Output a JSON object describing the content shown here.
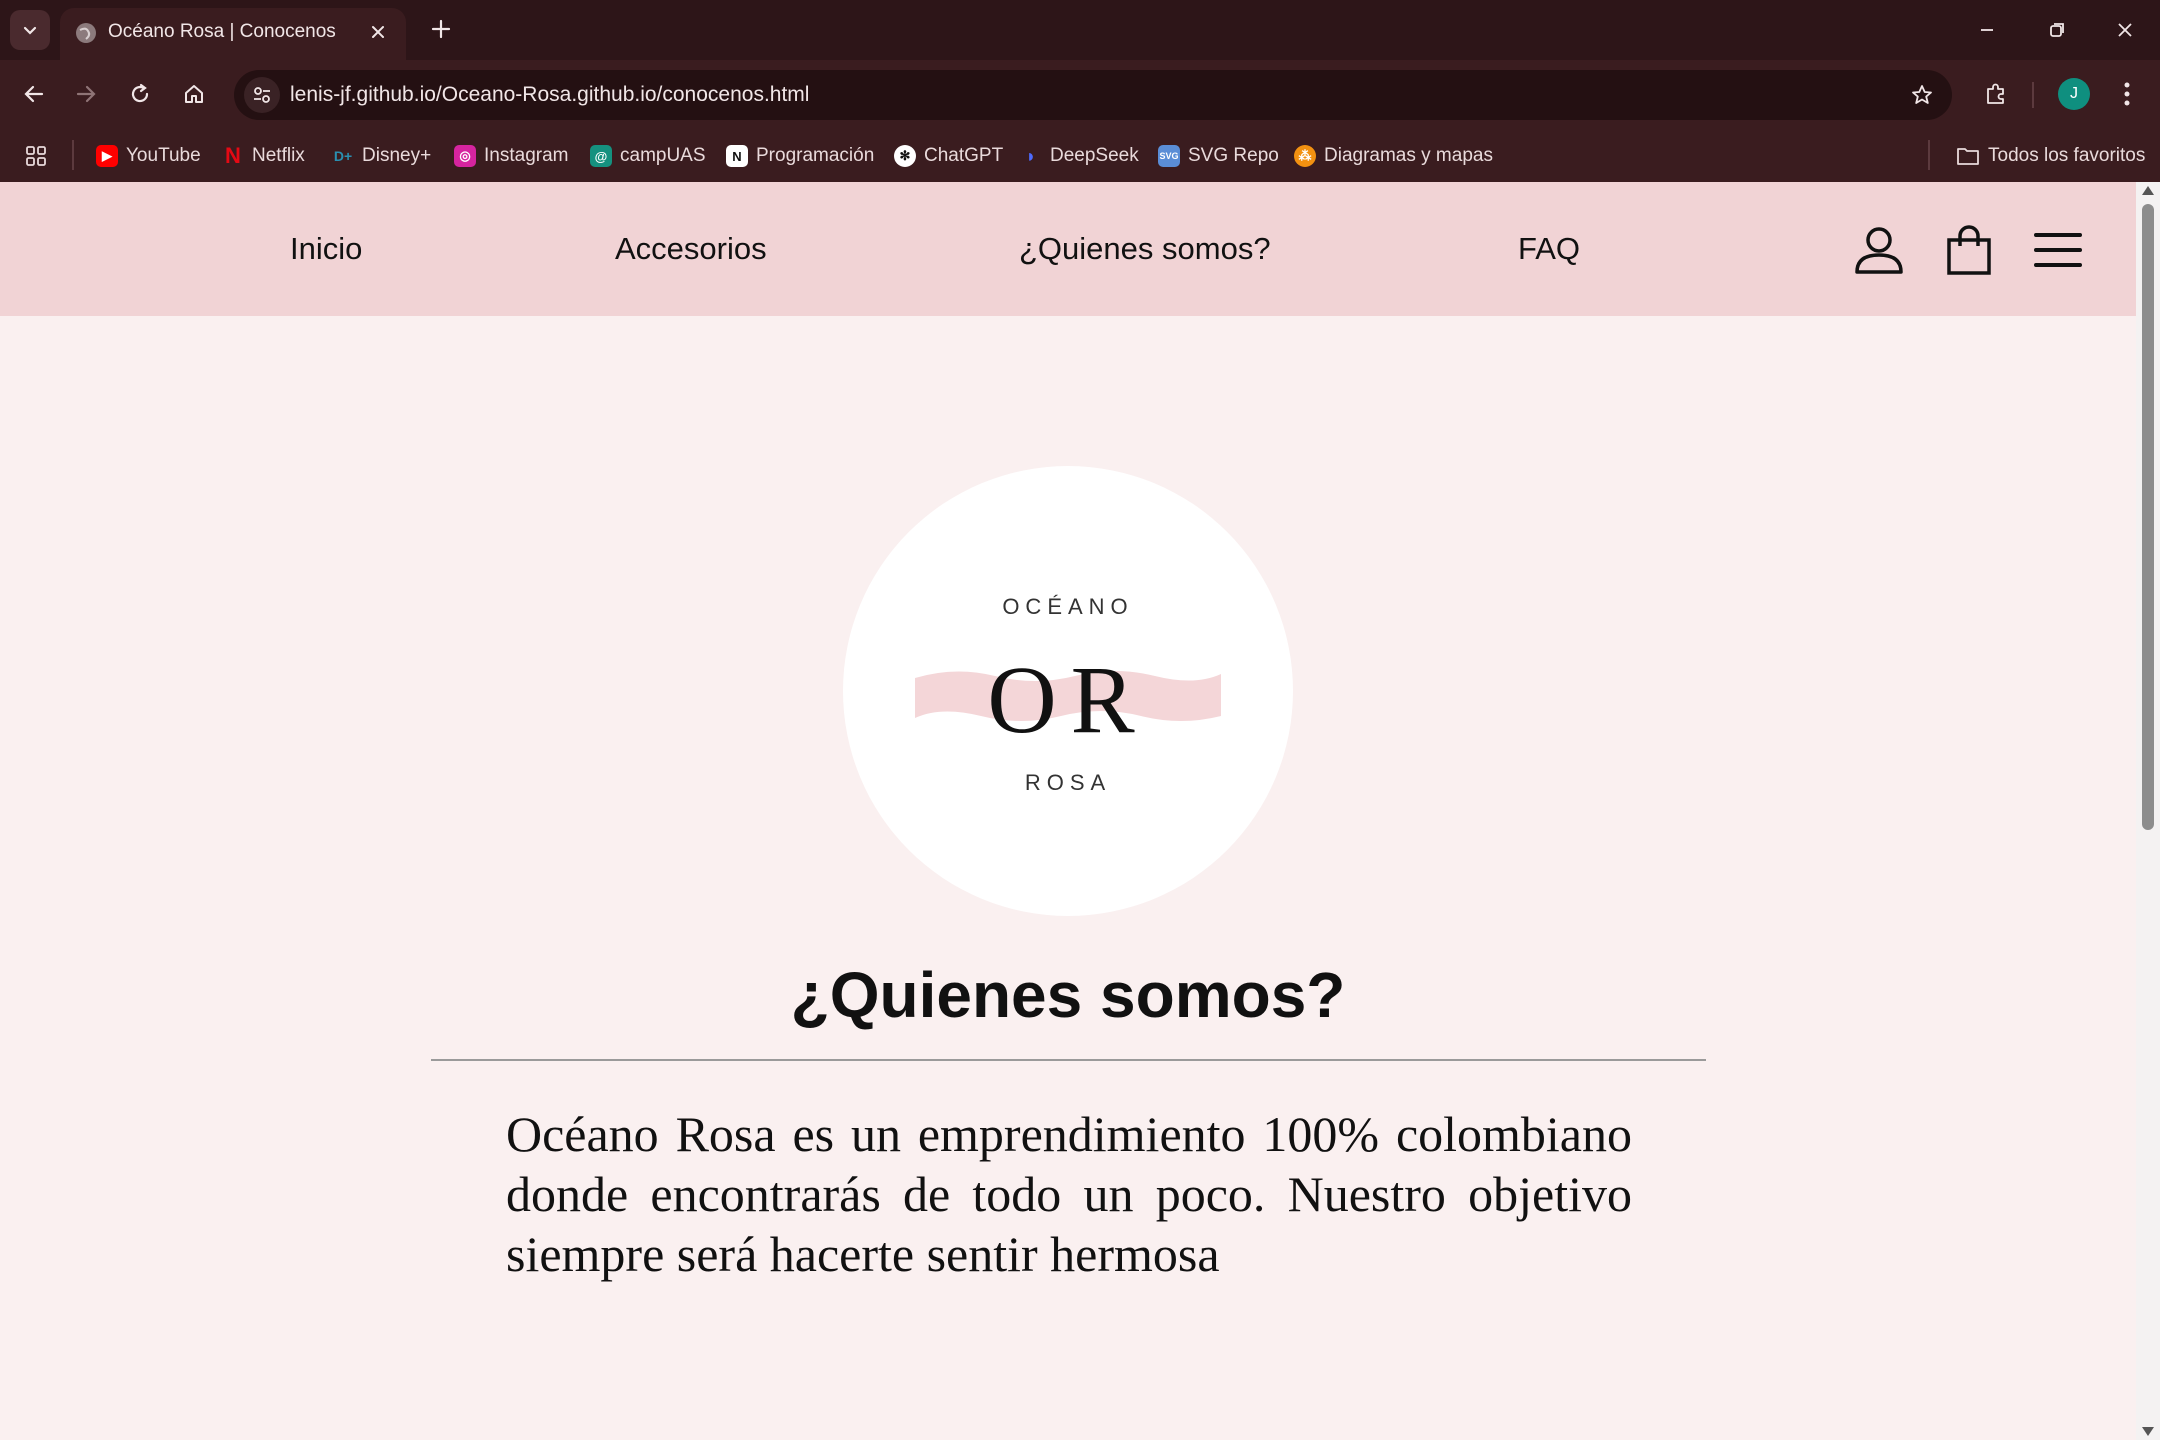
{
  "browser": {
    "tab_title": "Océano Rosa | Conocenos",
    "url": "lenis-jf.github.io/Oceano-Rosa.github.io/conocenos.html",
    "profile_initial": "J",
    "bookmarks": [
      {
        "label": "YouTube",
        "icon": "youtube-icon",
        "color": "#ff0000"
      },
      {
        "label": "Netflix",
        "icon": "netflix-icon",
        "color": "#e50914"
      },
      {
        "label": "Disney+",
        "icon": "disney-plus-icon",
        "color": "#1f6f8b"
      },
      {
        "label": "Instagram",
        "icon": "instagram-icon",
        "color": "#d6249f"
      },
      {
        "label": "campUAS",
        "icon": "campuas-icon",
        "color": "#15917f"
      },
      {
        "label": "Programación",
        "icon": "notion-icon",
        "color": "#ffffff"
      },
      {
        "label": "ChatGPT",
        "icon": "chatgpt-icon",
        "color": "#ffffff"
      },
      {
        "label": "DeepSeek",
        "icon": "deepseek-icon",
        "color": "#4d6bfe"
      },
      {
        "label": "SVG Repo",
        "icon": "svg-repo-icon",
        "color": "#5a8dd6"
      },
      {
        "label": "Diagramas y mapas",
        "icon": "diagrams-icon",
        "color": "#f29111"
      }
    ],
    "all_bookmarks_label": "Todos los favoritos"
  },
  "site": {
    "nav": {
      "inicio": "Inicio",
      "accesorios": "Accesorios",
      "quienes": "¿Quienes somos?",
      "faq": "FAQ"
    },
    "logo": {
      "top_text": "OCÉANO",
      "monogram": "OR",
      "bottom_text": "ROSA"
    },
    "heading": "¿Quienes somos?",
    "about_text": "Océano Rosa es un emprendimiento 100% colombiano donde encontrarás de todo un poco. Nuestro objetivo siempre será hacerte sentir hermosa"
  },
  "colors": {
    "chrome_bg": "#3a1c1f",
    "nav_bg": "#f1d3d5",
    "page_bg": "#faf0f0",
    "logo_wave": "#f4d6d8"
  }
}
